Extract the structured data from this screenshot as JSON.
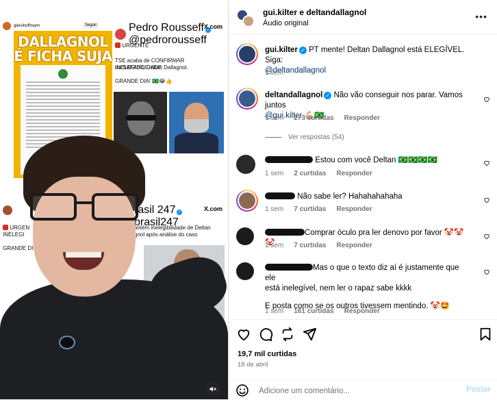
{
  "media": {
    "left_top_handle": "gleisihoffmann",
    "left_follow": "Seguir",
    "poster_title": "DALLAGNOL É FICHA SUJA",
    "tweet1_user": "Pedro Rousseff",
    "tweet1_handle": "@pedrorousseff",
    "tweet1_source": "X.com",
    "tweet1_flag": "URGENTE",
    "tweet1_line1": "TSE acaba de CONFIRMAR INELEGIBILIDADE",
    "tweet1_line2": "do SAFADO Deltan Dallagnol.",
    "tweet1_line3": "GRANDE DIA! 🇧🇷😂👍",
    "tweet2_user": "rasil 247",
    "tweet2_handle": "brasil247",
    "tweet2_source": "X.com",
    "tweet2_flag": "URGEN",
    "tweet2_line1": "antém inelegibilidade de Deltan",
    "tweet2_line2": "gnol após análise do caso",
    "tweet2_prefix": "INELEGI",
    "tweet2_grand": "GRANDE DI"
  },
  "header": {
    "title": "gui.kilter e deltandallagnol",
    "subtitle": "Áudio original",
    "more": "•••"
  },
  "caption": {
    "user": "gui.kilter",
    "text": " PT mente! Deltan Dallagnol está ELEGÍVEL. Siga:",
    "mention": "@deltandallagnol",
    "time": "1 sem"
  },
  "comments": [
    {
      "user": "deltandallagnol",
      "text": " Não vão conseguir nos parar. Vamos juntos",
      "mention": "@gui.kilter",
      "suffix": " 💪🏼🇧🇷",
      "time": "1 sem",
      "likes": "273 curtidas",
      "reply": "Responder",
      "view_replies": "Ver respostas (54)"
    },
    {
      "text": "Estou com você Deltan 🇧🇷🇧🇷🇧🇷🇧🇷",
      "time": "1 sem",
      "likes": "2 curtidas",
      "reply": "Responder"
    },
    {
      "text": "Não sabe ler? Hahahahahaha",
      "time": "1 sem",
      "likes": "7 curtidas",
      "reply": "Responder"
    },
    {
      "text": "Comprar óculo pra ler denovo por favor 🤡🤡🤡",
      "time": "1 sem",
      "likes": "7 curtidas",
      "reply": "Responder"
    },
    {
      "text": "Mas o que o texto diz aí é justamente que ele",
      "text2": "está inelegível, nem ler o rapaz sabe kkkk",
      "text3": "E posta como se os outros tivessem mentindo. 🤡🤩",
      "time": "1 sem",
      "likes": "161 curtidas",
      "reply": "Responder"
    }
  ],
  "footer": {
    "likes": "19,7 mil curtidas",
    "date": "18 de abril",
    "placeholder": "Adicione um comentário...",
    "post": "Postar"
  },
  "colors": {
    "link": "#00376b",
    "muted": "#737373",
    "verified": "#0095f6",
    "post_disabled": "#b2dffc"
  }
}
